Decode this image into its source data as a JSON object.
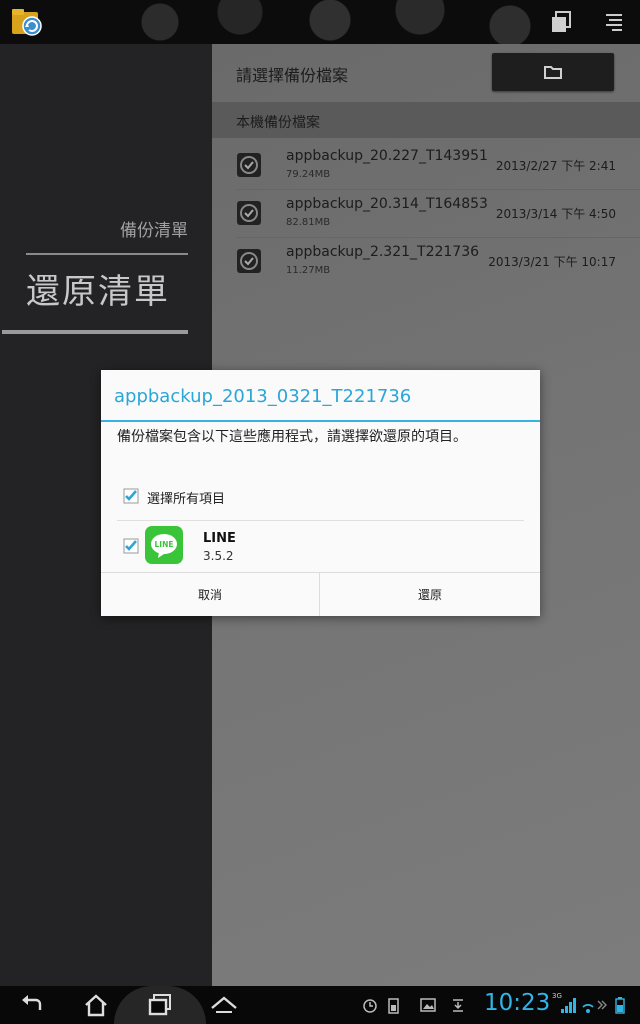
{
  "left_nav": {
    "backup_list": "備份清單",
    "restore_list": "還原清單"
  },
  "right_panel": {
    "title": "請選擇備份檔案",
    "folder_icon": "folder-icon",
    "section_header": "本機備份檔案",
    "files": [
      {
        "name": "appbackup_20.227_T143951",
        "size": "79.24MB",
        "date": "2013/2/27 下午 2:41"
      },
      {
        "name": "appbackup_20.314_T164853",
        "size": "82.81MB",
        "date": "2013/3/14 下午 4:50"
      },
      {
        "name": "appbackup_2.321_T221736",
        "size": "11.27MB",
        "date": "2013/3/21 下午 10:17"
      }
    ]
  },
  "dialog": {
    "title": "appbackup_2013_0321_T221736",
    "message": "備份檔案包含以下這些應用程式，請選擇欲還原的項目。",
    "select_all_label": "選擇所有項目",
    "select_all_checked": true,
    "apps": [
      {
        "name": "LINE",
        "version": "3.5.2",
        "checked": true
      }
    ],
    "cancel_label": "取消",
    "restore_label": "還原"
  },
  "status_bar": {
    "time": "10:23",
    "network": "3G"
  },
  "colors": {
    "accent": "#32b4e5",
    "line_green": "#3ac43a",
    "checkbox": "#2aa6d8"
  }
}
